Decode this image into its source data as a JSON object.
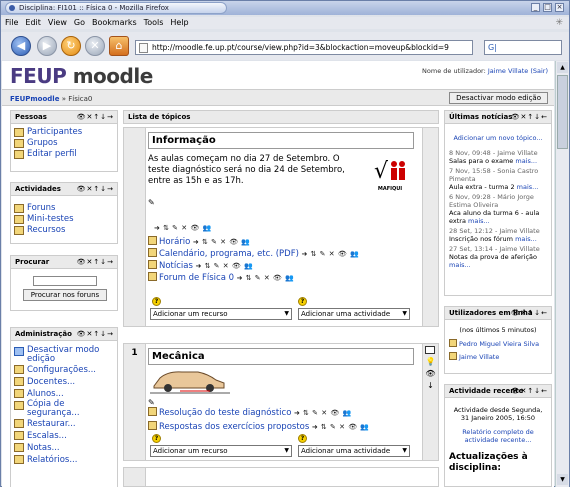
{
  "window": {
    "title": "Disciplina: FI101 :: Física 0 - Mozilla Firefox"
  },
  "menu": [
    "File",
    "Edit",
    "View",
    "Go",
    "Bookmarks",
    "Tools",
    "Help"
  ],
  "url": "http://moodle.fe.up.pt/course/view.php?id=3&blockaction=moveup&blockid=9",
  "search_placeholder": "",
  "logo": {
    "a": "FEUP",
    "b": "moodle"
  },
  "user": {
    "prefix": "Nome de utilizador:",
    "name": "Jaime Villate",
    "logout": "(Sair)"
  },
  "breadcrumb": {
    "home": "FEUPmoodle",
    "sep": "»",
    "course": "Física0"
  },
  "edit_button": "Desactivar modo edição",
  "controls": "👁 ✕ ↓ →",
  "people": {
    "title": "Pessoas",
    "items": [
      "Participantes",
      "Grupos",
      "Editar perfil"
    ]
  },
  "activities": {
    "title": "Actividades",
    "items": [
      "Foruns",
      "Mini-testes",
      "Recursos"
    ]
  },
  "search_block": {
    "title": "Procurar",
    "button": "Procurar nos foruns"
  },
  "admin": {
    "title": "Administração",
    "items": [
      "Desactivar modo edição",
      "Configurações...",
      "Docentes...",
      "Alunos...",
      "Cópia de segurança...",
      "Restaurar...",
      "Escalas...",
      "Notas...",
      "Relatórios..."
    ]
  },
  "topics_header": "Lista de tópicos",
  "section0": {
    "title": "Informação",
    "text": "As aulas começam no dia 27 de Setembro. O teste diagnóstico será no dia 24 de Setembro, entre as 15h e as 17h.",
    "logo_caption": "MAFIQUI",
    "links": [
      "Horário",
      "Calendário, programa, etc. (PDF)",
      "Notícias",
      "Forum de Física 0"
    ],
    "add_resource": "Adicionar um recurso",
    "add_activity": "Adicionar uma actividade"
  },
  "section1": {
    "number": "1",
    "title": "Mecânica",
    "links": [
      "Resolução do teste diagnóstico",
      "Respostas dos exercícios propostos"
    ],
    "add_resource": "Adicionar um recurso",
    "add_activity": "Adicionar uma actividade"
  },
  "news": {
    "title": "Últimas notícias",
    "add": "Adicionar um novo tópico...",
    "items": [
      {
        "date": "8 Nov, 09:48 - Jaime Villate",
        "text": "Salas para o exame",
        "more": "mais..."
      },
      {
        "date": "7 Nov, 15:58 - Sonia Castro Pimenta",
        "text": "Aula extra - turma 2",
        "more": "mais..."
      },
      {
        "date": "6 Nov, 09:28 - Mário Jorge Estima Oliveira",
        "text": "Aca aluno da turma 6 - aula extra",
        "more": "mais..."
      },
      {
        "date": "28 Set, 12:12 - Jaime Villate",
        "text": "Inscrição nos fórum",
        "more": "mais..."
      },
      {
        "date": "27 Set, 13:14 - Jaime Villate",
        "text": "Notas da prova de aferição",
        "more": "mais..."
      }
    ]
  },
  "online": {
    "title": "Utilizadores em linha",
    "subtitle": "(nos últimos 5 minutos)",
    "users": [
      "Pedro Miguel Vieira Silva",
      "Jaime Villate"
    ]
  },
  "recent": {
    "title": "Actividade recente",
    "since": "Actividade desde Segunda, 31 Janeiro 2005, 16:50",
    "full": "Relatório completo de actividade recente...",
    "updates": "Actualizações à disciplina:"
  }
}
